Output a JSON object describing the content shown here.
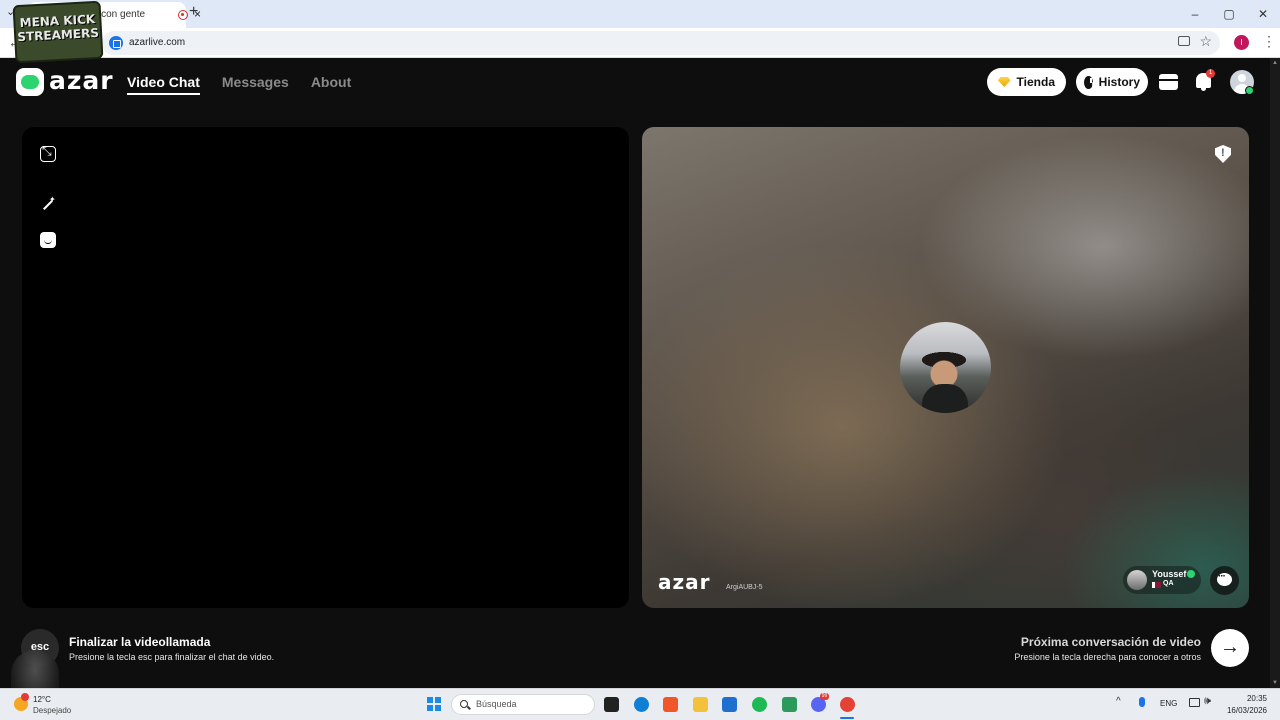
{
  "browser": {
    "tab": {
      "title": "at con gente",
      "close": "×"
    },
    "tab_list_glyph": "⌄",
    "new_tab": "+",
    "window_controls": [
      "–",
      "▢",
      "✕"
    ],
    "back_glyph": "←",
    "url": "azarlive.com",
    "star_glyph": "☆",
    "profile_initial": "I",
    "menu_glyph": "⋮"
  },
  "overlay_logo": {
    "lines": [
      "MENA KICK",
      "STREAMERS"
    ]
  },
  "header": {
    "logo_text": "azar",
    "nav": [
      {
        "label": "Video Chat",
        "active": true
      },
      {
        "label": "Messages",
        "active": false
      },
      {
        "label": "About",
        "active": false
      }
    ],
    "tienda_label": "Tienda",
    "history_label": "History",
    "notification_count": "1"
  },
  "remote_panel": {
    "watermark": "azar",
    "code": "ArgiAUBJ-5",
    "partner": {
      "name": "Youssef",
      "country": "QA"
    }
  },
  "actions": {
    "end": {
      "key": "esc",
      "title": "Finalizar la videollamada",
      "description": "Presione la tecla esc para finalizar el chat de video."
    },
    "next": {
      "key_glyph": "→",
      "title": "Próxima conversación de video",
      "description": "Presione la tecla derecha para conocer a otros"
    }
  },
  "taskbar": {
    "weather_temp": "12°C",
    "weather_desc": "Despejado",
    "search_placeholder": "Búsqueda",
    "apps": [
      {
        "name": "task-view",
        "color": "#222222"
      },
      {
        "name": "edge",
        "color": "#0f7fd6"
      },
      {
        "name": "brave",
        "color": "#f1562b"
      },
      {
        "name": "file-explorer",
        "color": "#f3c13a"
      },
      {
        "name": "store",
        "color": "#1f6fd1"
      },
      {
        "name": "spotify",
        "color": "#1db954"
      },
      {
        "name": "android-app",
        "color": "#2c9a5b"
      },
      {
        "name": "discord",
        "color": "#5865f2"
      },
      {
        "name": "chrome",
        "color": "#e34234"
      }
    ],
    "discord_badge": "99",
    "tray_caret": "^",
    "language": "ENG",
    "volume_glyph": "🕪",
    "time": "20:35",
    "date": "16/03/2026"
  },
  "colors": {
    "accent_green": "#2bd46e",
    "app_background": "#0e0e0e",
    "alert_red": "#e53935"
  }
}
